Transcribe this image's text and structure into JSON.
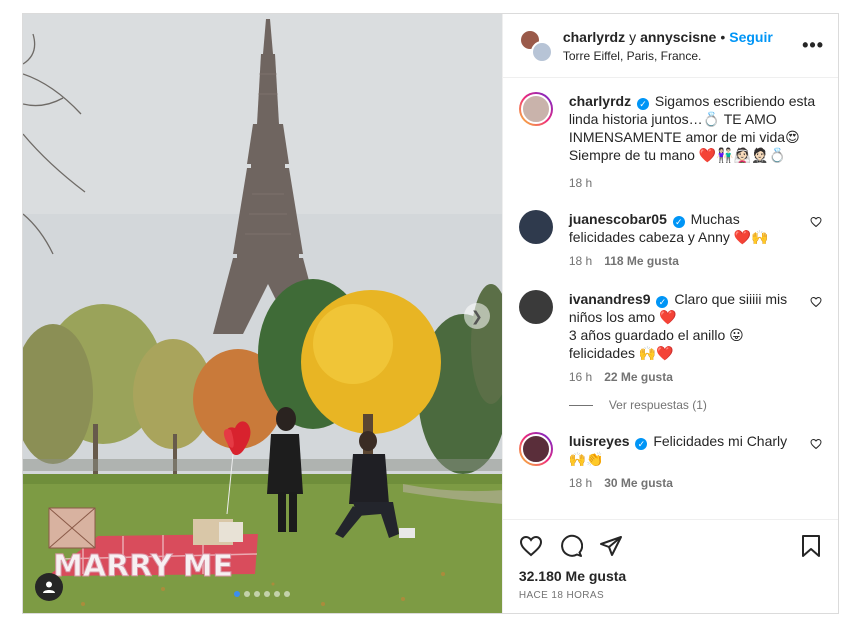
{
  "header": {
    "user1": "charlyrdz",
    "conjunction": "y",
    "user2": "annyscisne",
    "separator": "•",
    "follow_label": "Seguir",
    "location": "Torre Eiffel, Paris, France.",
    "more_icon": "more-horizontal-icon"
  },
  "caption": {
    "user": "charlyrdz",
    "text_line1": "Sigamos escribiendo esta",
    "text_line2": "linda historia juntos…💍 TE AMO",
    "text_line3": "INMENSAMENTE amor de mi vida😍",
    "text_line4": "Siempre de tu mano ❤️👫🏻👰🏻🤵🏻💍",
    "time": "18 h"
  },
  "comments": [
    {
      "user": "juanescobar05",
      "text_line1": "Muchas",
      "text_line2": "felicidades cabeza y Anny ❤️🙌",
      "time": "18 h",
      "likes": "118 Me gusta"
    },
    {
      "user": "ivanandres9",
      "text_line1": "Claro que siiiii mis",
      "text_line2": "niños los amo ❤️",
      "text_line3": "3 años guardado el anillo 😛",
      "text_line4": "felicidades 🙌❤️",
      "time": "16 h",
      "likes": "22 Me gusta",
      "replies_label": "Ver respuestas (1)"
    },
    {
      "user": "luisreyes",
      "text_line1": "Felicidades mi Charly",
      "text_line2": "🙌👏",
      "time": "18 h",
      "likes": "30 Me gusta"
    }
  ],
  "actions": {
    "likes_total": "32.180 Me gusta",
    "posted_ago": "HACE 18 HORAS"
  },
  "media": {
    "sign_text": "MARRY ME",
    "carousel_count": 6,
    "carousel_active": 0
  },
  "colors": {
    "link_blue": "#0095f6",
    "heart_red": "#e0245e"
  }
}
